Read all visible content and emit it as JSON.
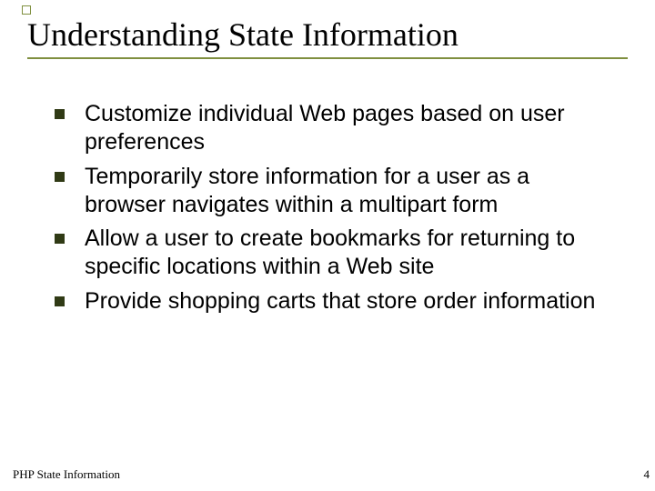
{
  "title": "Understanding State Information",
  "bullets": [
    "Customize individual Web pages based on user preferences",
    "Temporarily store information for a user as a browser navigates within a multipart form",
    "Allow a user to create bookmarks for returning to specific locations within a Web site",
    "Provide shopping carts that store order information"
  ],
  "footer": "PHP State Information",
  "page_number": "4",
  "colors": {
    "rule": "#7f8f3f",
    "bullet": "#303a15"
  }
}
